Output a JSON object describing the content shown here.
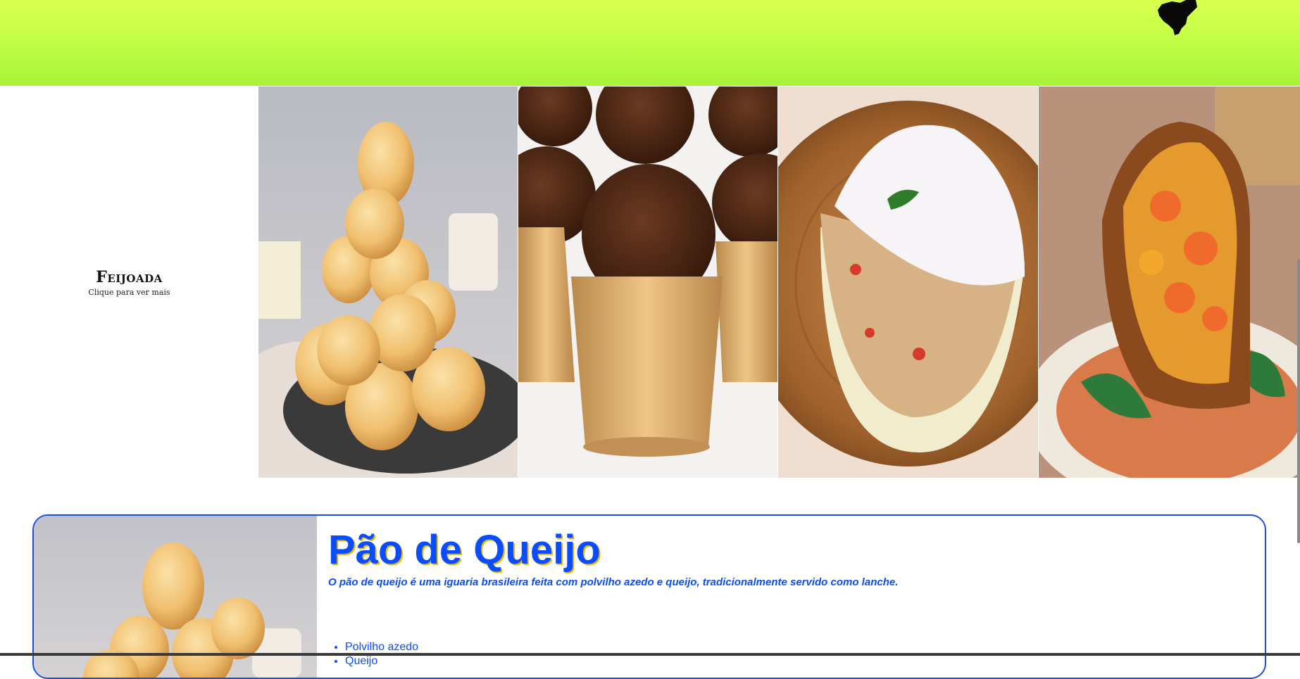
{
  "header": {
    "logo_icon": "region-map-icon",
    "colors": {
      "top": "#d9ff4d",
      "bottom": "#a8f23a"
    }
  },
  "carousel": {
    "active": {
      "title": "Feijoada",
      "subtitle": "Clique para ver mais"
    },
    "images": [
      {
        "name": "pao-de-queijo-image"
      },
      {
        "name": "brigadeiro-image"
      },
      {
        "name": "tapioca-image"
      },
      {
        "name": "acaraje-image"
      }
    ]
  },
  "card": {
    "title": "Pão de Queijo",
    "description": "O pão de queijo é uma iguaria brasileira feita com polvilho azedo e queijo, tradicionalmente servido como lanche.",
    "ingredients": [
      "Polvilho azedo",
      "Queijo"
    ],
    "colors": {
      "accent": "#0a4cff",
      "shadow": "#e6b800",
      "border": "#1a4de0"
    }
  }
}
